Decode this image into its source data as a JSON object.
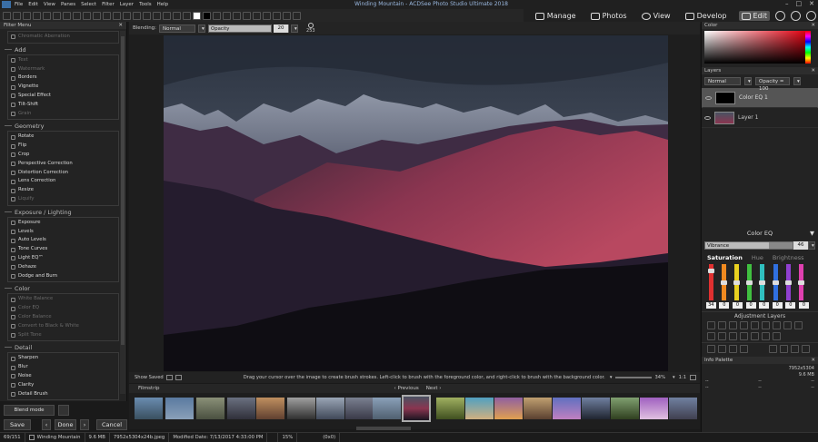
{
  "menu": [
    "File",
    "Edit",
    "View",
    "Panes",
    "Select",
    "Filter",
    "Layer",
    "Tools",
    "Help"
  ],
  "window_title": "Winding Mountain - ACDSee Photo Studio Ultimate 2018",
  "modes": [
    {
      "label": "Manage"
    },
    {
      "label": "Photos"
    },
    {
      "label": "View"
    },
    {
      "label": "Develop"
    },
    {
      "label": "Edit"
    }
  ],
  "filter_menu": {
    "title": "Filter Menu",
    "top_item": "Chromatic Aberration",
    "sections": [
      {
        "title": "Add",
        "items": [
          {
            "label": "Text",
            "enabled": false
          },
          {
            "label": "Watermark",
            "enabled": false
          },
          {
            "label": "Borders",
            "enabled": true
          },
          {
            "label": "Vignette",
            "enabled": true
          },
          {
            "label": "Special Effect",
            "enabled": true
          },
          {
            "label": "Tilt-Shift",
            "enabled": true
          },
          {
            "label": "Grain",
            "enabled": false
          }
        ]
      },
      {
        "title": "Geometry",
        "items": [
          {
            "label": "Rotate",
            "enabled": true
          },
          {
            "label": "Flip",
            "enabled": true
          },
          {
            "label": "Crop",
            "enabled": true
          },
          {
            "label": "Perspective Correction",
            "enabled": true
          },
          {
            "label": "Distortion Correction",
            "enabled": true
          },
          {
            "label": "Lens Correction",
            "enabled": true
          },
          {
            "label": "Resize",
            "enabled": true
          },
          {
            "label": "Liquify",
            "enabled": false
          }
        ]
      },
      {
        "title": "Exposure / Lighting",
        "items": [
          {
            "label": "Exposure",
            "enabled": true
          },
          {
            "label": "Levels",
            "enabled": true
          },
          {
            "label": "Auto Levels",
            "enabled": true
          },
          {
            "label": "Tone Curves",
            "enabled": true
          },
          {
            "label": "Light EQ™",
            "enabled": true
          },
          {
            "label": "Dehaze",
            "enabled": true
          },
          {
            "label": "Dodge and Burn",
            "enabled": true
          }
        ]
      },
      {
        "title": "Color",
        "items": [
          {
            "label": "White Balance",
            "enabled": false
          },
          {
            "label": "Color EQ",
            "enabled": false
          },
          {
            "label": "Color Balance",
            "enabled": false
          },
          {
            "label": "Convert to Black & White",
            "enabled": false
          },
          {
            "label": "Split Tone",
            "enabled": false
          }
        ]
      },
      {
        "title": "Detail",
        "items": [
          {
            "label": "Sharpen",
            "enabled": true
          },
          {
            "label": "Blur",
            "enabled": true
          },
          {
            "label": "Noise",
            "enabled": true
          },
          {
            "label": "Clarity",
            "enabled": true
          },
          {
            "label": "Detail Brush",
            "enabled": true
          }
        ]
      }
    ]
  },
  "bottom_buttons": {
    "blend_mode": "Blend mode",
    "save": "Save",
    "done": "Done",
    "cancel": "Cancel"
  },
  "options_bar": {
    "blending_label": "Blending:",
    "blending_value": "Normal",
    "opacity_label": "Opacity",
    "opacity_value": "20",
    "brush_size": "253"
  },
  "canvas_status": {
    "show_saved": "Show Saved",
    "hint": "Drag your cursor over the image to create brush strokes. Left-click to brush with the foreground color, and right-click to brush with the background color.",
    "zoom": "34%",
    "ratio": "1:1"
  },
  "filmstrip": {
    "title": "Filmstrip",
    "previous": "Previous",
    "next": "Next"
  },
  "statusbar": {
    "index": "69/151",
    "name": "Winding Mountain",
    "size": "9.6 MB",
    "file": "7952x5304x24b.jpeg",
    "modified": "Modified Date: 7/13/2017 4:33:00 PM",
    "zoom": "15%",
    "coords": "(0x0)"
  },
  "color_panel": {
    "title": "Color"
  },
  "layers_panel": {
    "title": "Layers",
    "blend": "Normal",
    "opacity": "Opacity = 100",
    "layers": [
      {
        "name": "Color EQ 1",
        "selected": true
      },
      {
        "name": "Layer 1",
        "selected": false
      }
    ]
  },
  "color_eq": {
    "title": "Color EQ",
    "slider_label": "Vibrance",
    "slider_value": "46",
    "slider_fraction": 0.73,
    "tabs": [
      "Saturation",
      "Hue",
      "Brightness"
    ],
    "channels": [
      {
        "value": "34",
        "level": 0.85,
        "color": "#e03030"
      },
      {
        "value": "0",
        "level": 0.5,
        "color": "#f08a20"
      },
      {
        "value": "0",
        "level": 0.5,
        "color": "#e8d020"
      },
      {
        "value": "0",
        "level": 0.5,
        "color": "#40c040"
      },
      {
        "value": "0",
        "level": 0.5,
        "color": "#30c0c0"
      },
      {
        "value": "0",
        "level": 0.5,
        "color": "#3070e0"
      },
      {
        "value": "0",
        "level": 0.5,
        "color": "#9040d0"
      },
      {
        "value": "0",
        "level": 0.5,
        "color": "#e040b0"
      }
    ]
  },
  "adjustment_layers": {
    "title": "Adjustment Layers"
  },
  "info_palette": {
    "title": "Info Palette",
    "dimensions": "7952x5304",
    "size": "9.6 MB",
    "placeholder": "--"
  }
}
